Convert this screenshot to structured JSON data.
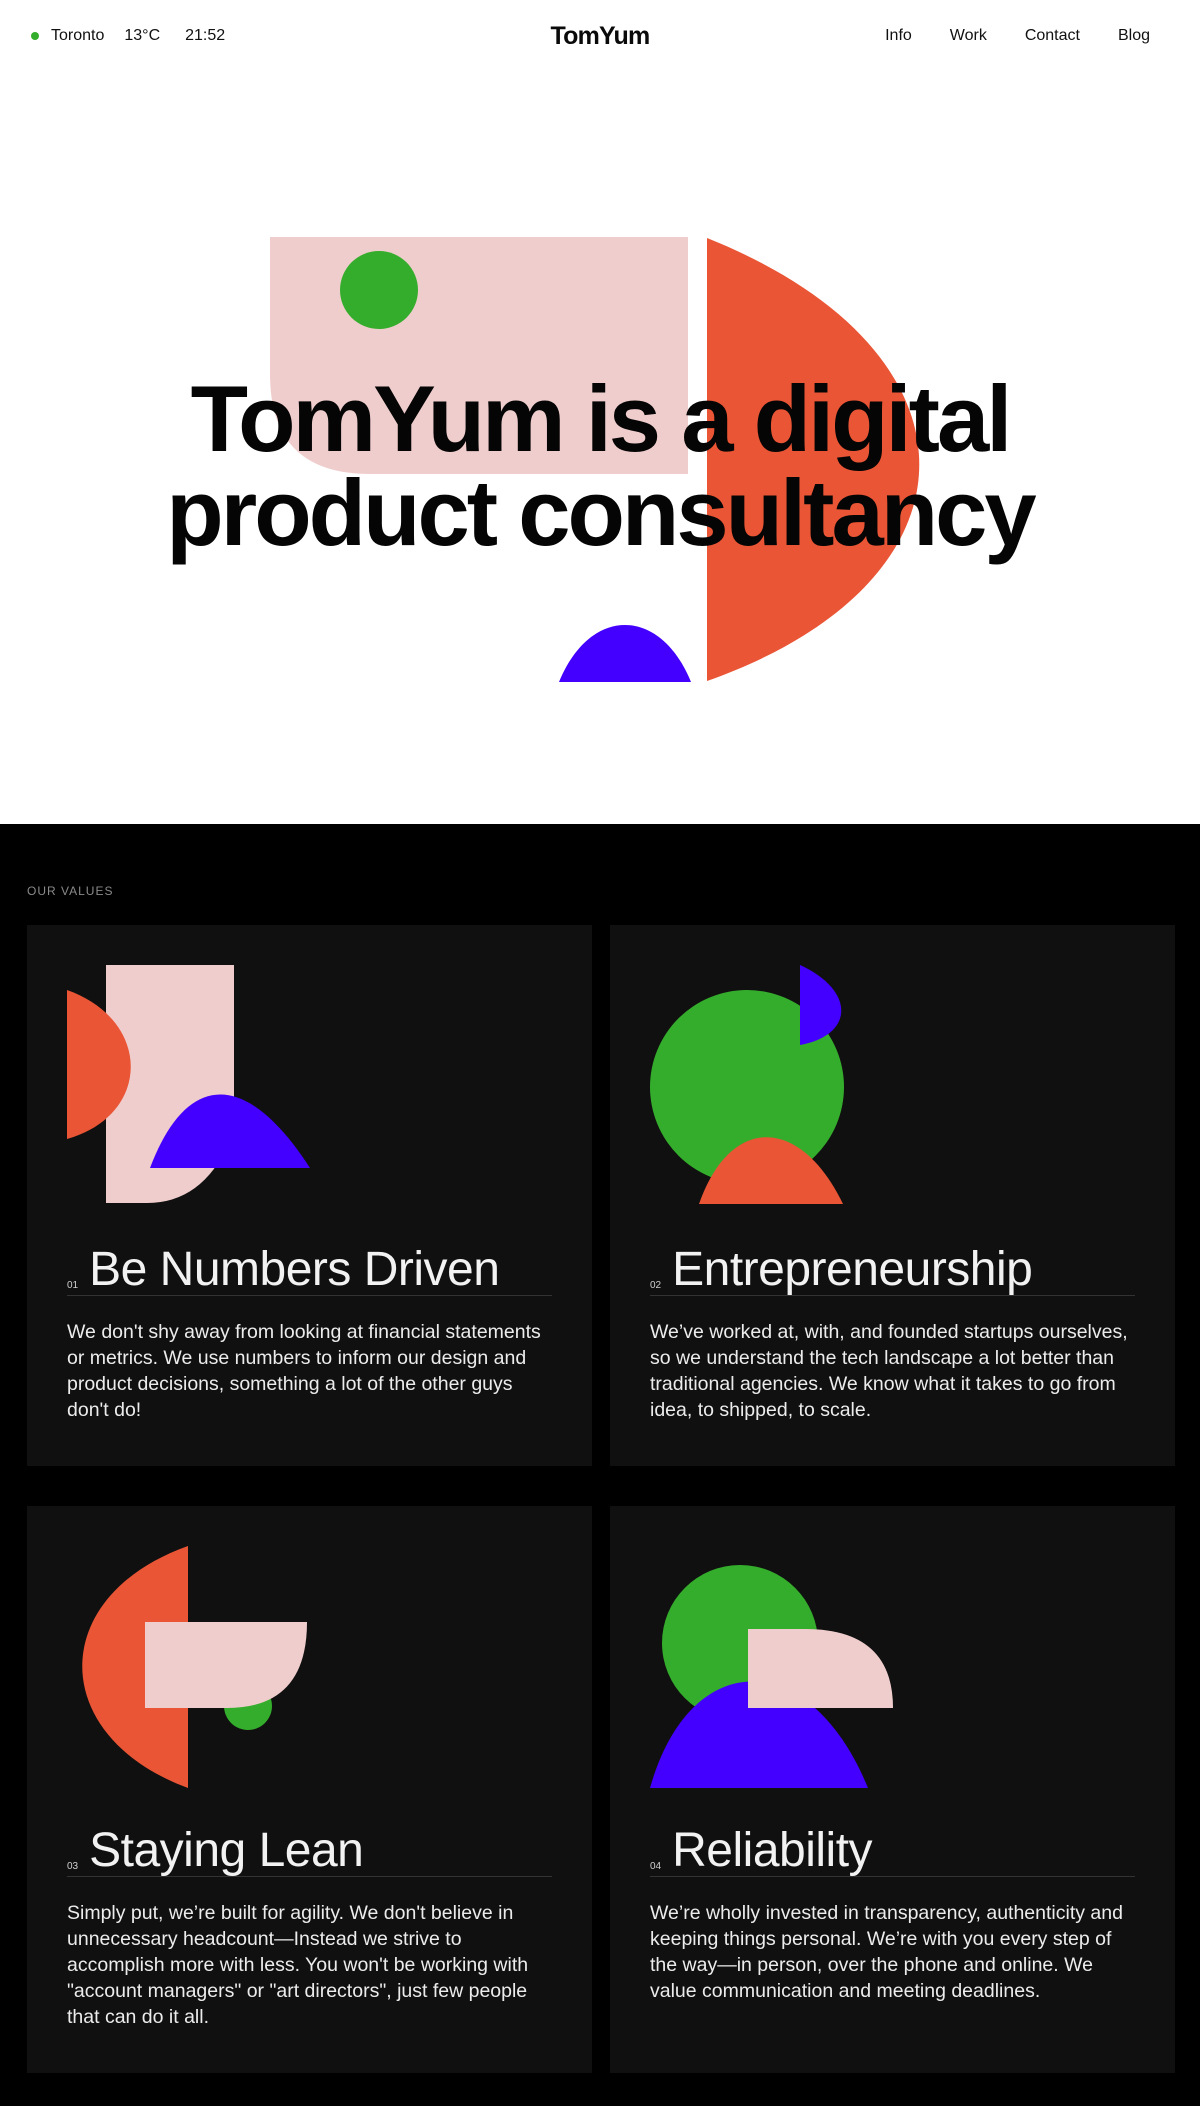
{
  "header": {
    "location": "Toronto",
    "temperature": "13°C",
    "time": "21:52",
    "logo": "TomYum",
    "nav": [
      "Info",
      "Work",
      "Contact",
      "Blog"
    ]
  },
  "hero": {
    "title_line1": "TomYum is a digital",
    "title_line2": "product consultancy"
  },
  "values": {
    "section_label": "OUR VALUES",
    "cards": [
      {
        "number": "01",
        "title": "Be Numbers Driven",
        "description": "We don't shy away from looking at financial statements or metrics. We use numbers to inform our design and product decisions, something a lot of the other guys don't do!"
      },
      {
        "number": "02",
        "title": "Entrepreneurship",
        "description": "We’ve worked at, with, and founded startups ourselves, so we understand the tech landscape a lot better than traditional agencies. We know what it takes to go from idea, to shipped, to scale."
      },
      {
        "number": "03",
        "title": "Staying Lean",
        "description": "Simply put, we’re built for agility. We don't believe in unnecessary headcount—Instead we strive to accomplish more with less. You won't be working with \"account managers\" or \"art directors\", just few people that can do it all."
      },
      {
        "number": "04",
        "title": "Reliability",
        "description": "We’re wholly invested in transparency, authenticity and keeping things personal. We’re with you every step of the way—in person, over the phone and online. We value communication and meeting deadlines."
      }
    ]
  },
  "colors": {
    "green": "#34ad2c",
    "pink": "#f0cdcd",
    "orange": "#ea5535",
    "blue": "#4400ff",
    "card_bg": "#101010"
  }
}
